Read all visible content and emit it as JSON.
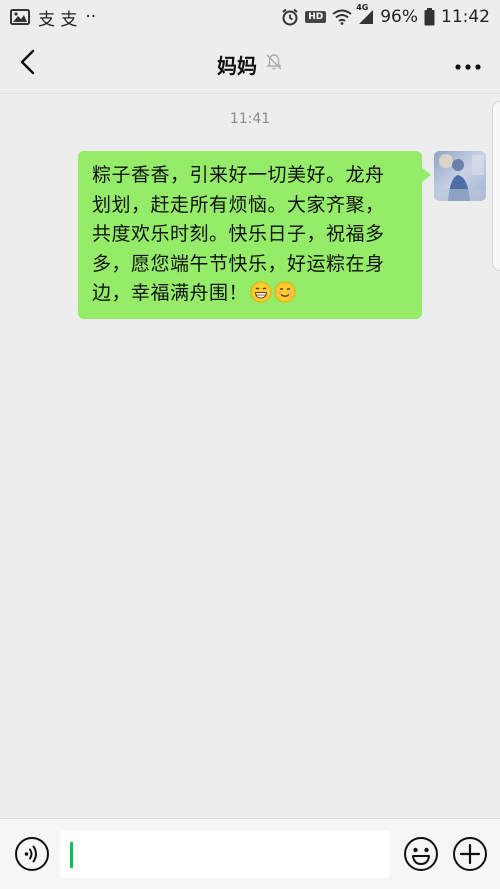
{
  "status_bar": {
    "left_text": "支 支",
    "dots": "··",
    "hd": "HD",
    "network": "4G",
    "battery": "96%",
    "time": "11:42"
  },
  "nav": {
    "title": "妈妈",
    "icons": {
      "back": "back-chevron-icon",
      "mute": "mute-bell-icon",
      "more": "more-dots-icon"
    }
  },
  "chat": {
    "timestamp": "11:41",
    "message": {
      "lines": [
        "粽子香香，引来好一切美好。龙舟",
        "划划，赶走所有烦恼。大家齐聚，",
        "共度欢乐时刻。快乐日子，祝福多",
        "多，愿您端午节快乐，好运粽在身",
        "边，幸福满舟围！"
      ],
      "emojis": [
        "grinning-face-icon",
        "smiling-face-icon"
      ],
      "bubble_color": "#95ec69"
    }
  },
  "input_bar": {
    "value": "",
    "caret_color": "#07c160",
    "icons": {
      "voice": "voice-icon",
      "emoji": "emoji-icon",
      "plus": "plus-icon"
    }
  }
}
